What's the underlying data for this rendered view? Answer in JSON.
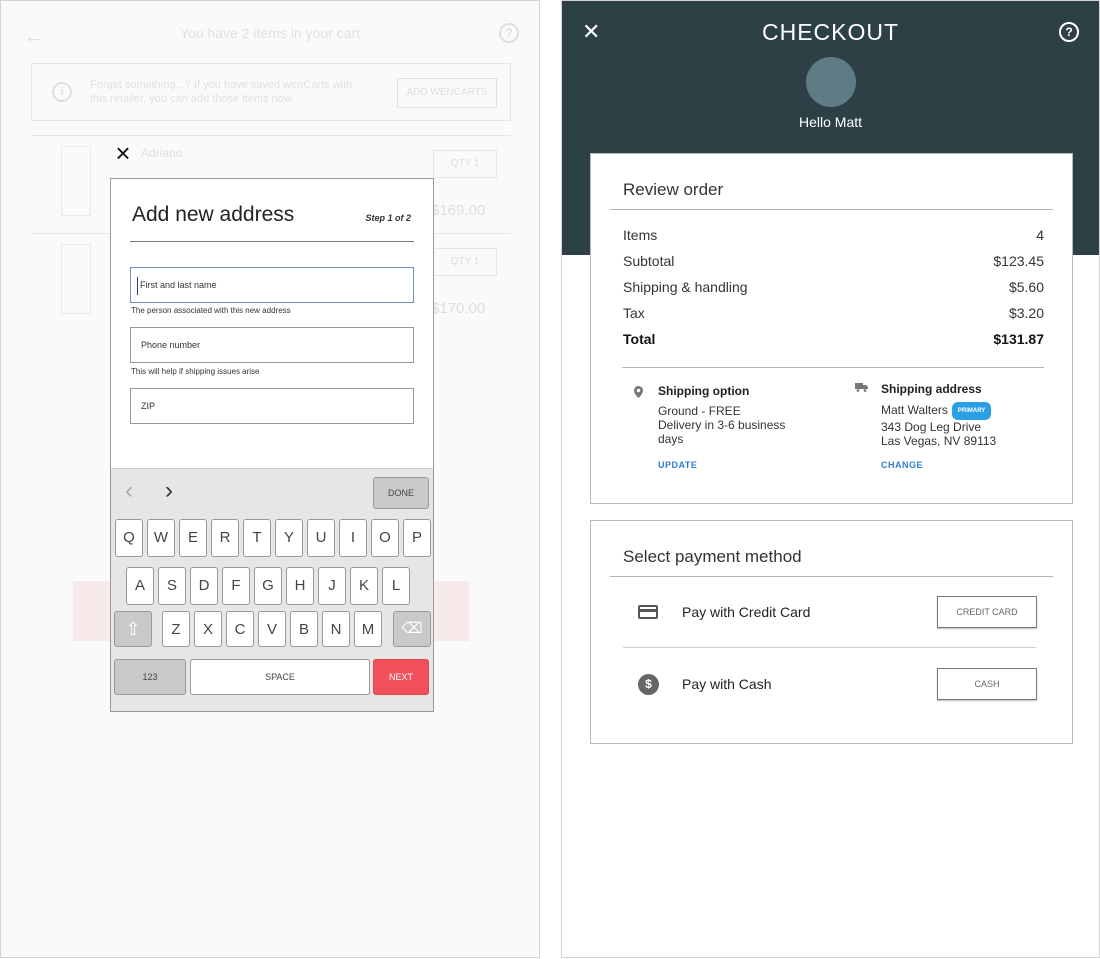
{
  "left_screen": {
    "background": {
      "cart_title": "You have 2 items in your cart",
      "banner_text": "Forget something...? If you have saved wenCarts with this retailer, you can add those items now.",
      "banner_button": "ADD WENCARTS",
      "item_1": {
        "name": "Adriano",
        "qty": "QTY 1",
        "price": "$169.00"
      },
      "item_2": {
        "qty": "QTY 1",
        "price": "$170.00"
      }
    },
    "modal": {
      "title": "Add new address",
      "step": "Step 1 of 2",
      "fields": {
        "name_placeholder": "First and last name",
        "name_hint": "The person associated with this new address",
        "phone_placeholder": "Phone number",
        "phone_hint": "This will help if shipping issues arise",
        "zip_placeholder": "ZIP"
      }
    },
    "keyboard": {
      "done_label": "DONE",
      "row1": [
        "Q",
        "W",
        "E",
        "R",
        "T",
        "Y",
        "U",
        "I",
        "O",
        "P"
      ],
      "row2": [
        "A",
        "S",
        "D",
        "F",
        "G",
        "H",
        "J",
        "K",
        "L"
      ],
      "row3": [
        "Z",
        "X",
        "C",
        "V",
        "B",
        "N",
        "M"
      ],
      "numbers_label": "123",
      "space_label": "SPACE",
      "next_label": "NEXT"
    }
  },
  "right_screen": {
    "header": {
      "title": "CHECKOUT",
      "greeting": "Hello Matt"
    },
    "review": {
      "title": "Review order",
      "rows": [
        {
          "label": "Items",
          "value": "4"
        },
        {
          "label": "Subtotal",
          "value": "$123.45"
        },
        {
          "label": "Shipping & handling",
          "value": "$5.60"
        },
        {
          "label": "Tax",
          "value": "$3.20"
        }
      ],
      "total": {
        "label": "Total",
        "value": "$131.87"
      },
      "shipping_option": {
        "heading": "Shipping option",
        "line1": "Ground - FREE",
        "line2": "Delivery in 3-6 business",
        "line3": "days",
        "action": "UPDATE"
      },
      "shipping_address": {
        "heading": "Shipping address",
        "name": "Matt Walters",
        "badge": "PRIMARY",
        "street": "343 Dog Leg Drive",
        "city": "Las Vegas, NV 89113",
        "action": "CHANGE"
      }
    },
    "payment": {
      "title": "Select payment method",
      "credit": {
        "label": "Pay with Credit Card",
        "button": "CREDIT CARD"
      },
      "cash": {
        "label": "Pay with Cash",
        "button": "CASH",
        "icon_glyph": "$"
      }
    }
  },
  "colors": {
    "header_bg": "#2d4046",
    "accent_link": "#2f7fd1",
    "next_key": "#f1515a",
    "primary_badge": "#2b9fe6"
  }
}
